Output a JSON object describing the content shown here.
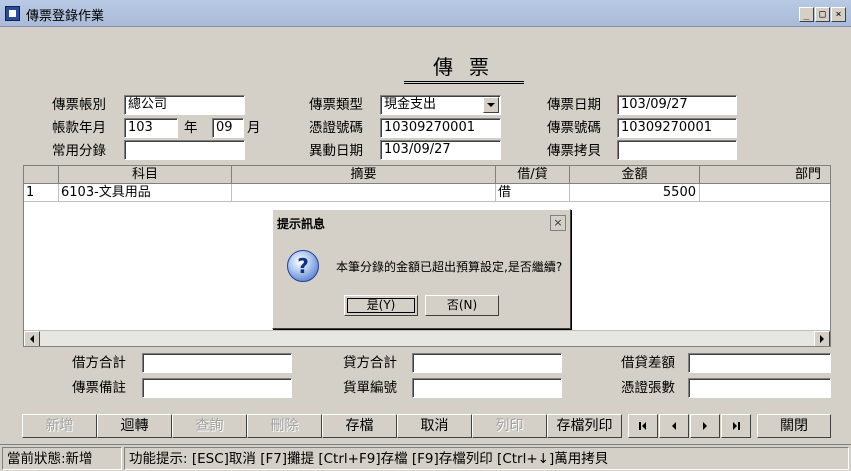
{
  "window": {
    "title": "傳票登錄作業",
    "minimize": "_",
    "maximize": "□",
    "close": "×"
  },
  "form": {
    "title": "傳票",
    "fields": {
      "ledger_label": "傳票帳別",
      "ledger_value": "總公司",
      "period_label": "帳款年月",
      "year_value": "103",
      "year_unit": "年",
      "month_value": "09",
      "month_unit": "月",
      "template_label": "常用分錄",
      "template_value": "",
      "type_label": "傳票類型",
      "type_value": "現金支出",
      "voucher_no_label": "憑證號碼",
      "voucher_no_value": "10309270001",
      "change_date_label": "異動日期",
      "change_date_value": "103/09/27",
      "date_label": "傳票日期",
      "date_value": "103/09/27",
      "number_label": "傳票號碼",
      "number_value": "10309270001",
      "copy_label": "傳票拷貝",
      "copy_value": ""
    }
  },
  "grid": {
    "columns": [
      "科目",
      "摘要",
      "借/貸",
      "金額",
      "部門"
    ],
    "rows": [
      {
        "index": "1",
        "account": "6103-文具用品",
        "summary": "",
        "dc": "借",
        "amount": "5500",
        "dept": ""
      }
    ]
  },
  "dialog": {
    "title": "提示訊息",
    "close": "×",
    "icon": "question-icon",
    "icon_glyph": "?",
    "message": "本筆分錄的金額已超出預算設定,是否繼續?",
    "yes_label": "是(Y)",
    "no_label": "否(N)"
  },
  "totals": {
    "debit_total_label": "借方合計",
    "credit_total_label": "貸方合計",
    "difference_label": "借貸差額",
    "remark_label": "傳票備註",
    "bill_no_label": "貨單編號",
    "voucher_count_label": "憑證張數"
  },
  "toolbar": {
    "add": "新增",
    "reverse": "迴轉",
    "query": "查詢",
    "delete": "刪除",
    "save": "存檔",
    "cancel": "取消",
    "print": "列印",
    "save_print": "存檔列印",
    "close": "關閉"
  },
  "status": {
    "state": "當前狀態:新增",
    "hint": "功能提示: [ESC]取消 [F7]攤提 [Ctrl+F9]存檔 [F9]存檔列印 [Ctrl+↓]萬用拷貝"
  },
  "colors": {
    "window_bg": "#d4d0c8",
    "title_bar": "#b8c9e6"
  }
}
